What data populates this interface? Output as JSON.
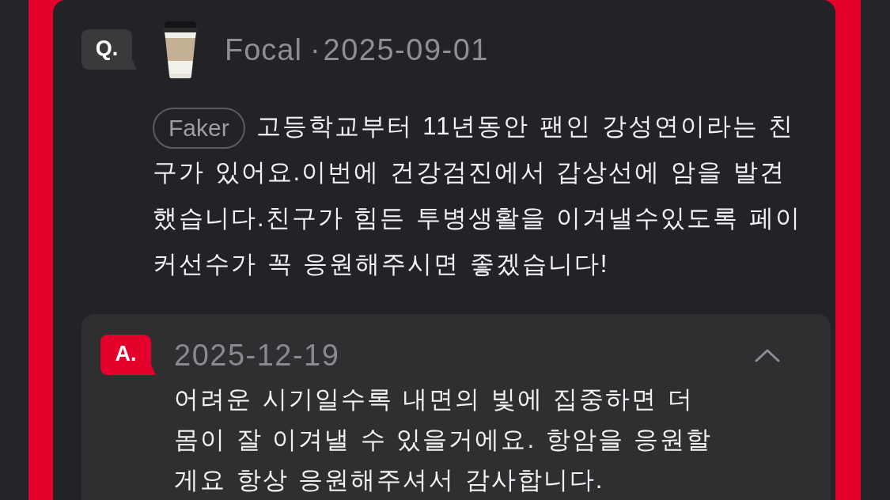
{
  "question": {
    "badge": "Q.",
    "author": "Focal",
    "separator": "·",
    "date": "2025-09-01",
    "tag": "Faker",
    "text": "고등학교부터 11년동안 팬인 강성연이라는 친구가 있어요.이번에 건강검진에서 갑상선에 암을 발견했습니다.친구가 힘든 투병생활을 이겨낼수있도록 페이커선수가 꼭 응원해주시면 좋겠습니다!"
  },
  "answer": {
    "badge": "A.",
    "date": "2025-12-19",
    "expanded": true,
    "text": "어려운 시기일수록 내면의 빛에 집중하면 더 몸이 잘 이겨낼 수 있을거에요. 항암을 응원할게요 항상 응원해주셔서 감사합니다."
  }
}
